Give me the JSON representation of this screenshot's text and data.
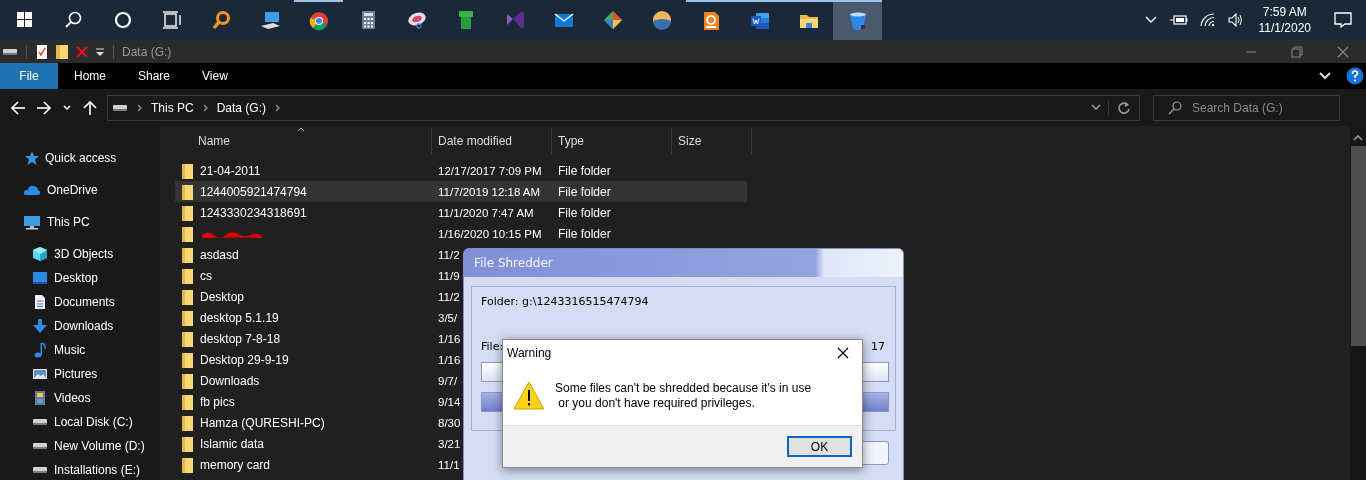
{
  "taskbar": {
    "buttons": [
      {
        "kind": "start",
        "running": false,
        "active": false
      },
      {
        "kind": "search",
        "running": false,
        "active": false
      },
      {
        "kind": "cortana",
        "running": false,
        "active": false
      },
      {
        "kind": "taskview",
        "running": false,
        "active": false
      },
      {
        "kind": "magnifier",
        "running": false,
        "active": false
      },
      {
        "kind": "computer",
        "running": false,
        "active": false
      },
      {
        "kind": "browser",
        "running": true,
        "active": false
      },
      {
        "kind": "calculator",
        "running": false,
        "active": false
      },
      {
        "kind": "disc",
        "running": false,
        "active": false
      },
      {
        "kind": "pipe",
        "running": false,
        "active": false
      },
      {
        "kind": "bow",
        "running": false,
        "active": false
      },
      {
        "kind": "mail",
        "running": false,
        "active": false
      },
      {
        "kind": "diamond",
        "running": false,
        "active": false
      },
      {
        "kind": "sunset",
        "running": false,
        "active": false
      },
      {
        "kind": "pdf",
        "running": true,
        "active": false
      },
      {
        "kind": "doc",
        "running": true,
        "active": false
      },
      {
        "kind": "folder",
        "running": true,
        "active": false
      },
      {
        "kind": "bucket",
        "running": true,
        "active": true
      }
    ],
    "tray": {
      "time": "7:59 AM",
      "date": "11/1/2020"
    }
  },
  "window": {
    "title": "Data (G:)"
  },
  "ribbon": {
    "tabs": [
      {
        "label": "File",
        "selected": true
      },
      {
        "label": "Home",
        "selected": false
      },
      {
        "label": "Share",
        "selected": false
      },
      {
        "label": "View",
        "selected": false
      }
    ]
  },
  "address": {
    "crumbs": [
      "This PC",
      "Data (G:)"
    ]
  },
  "search": {
    "placeholder": "Search Data (G:)"
  },
  "navigation": [
    {
      "label": "Quick access",
      "kind": "star"
    },
    {
      "label": "OneDrive",
      "kind": "cloud"
    },
    {
      "label": "This PC",
      "kind": "computer",
      "children": [
        {
          "label": "3D Objects",
          "kind": "cube"
        },
        {
          "label": "Desktop",
          "kind": "desktop"
        },
        {
          "label": "Documents",
          "kind": "document"
        },
        {
          "label": "Downloads",
          "kind": "download"
        },
        {
          "label": "Music",
          "kind": "note"
        },
        {
          "label": "Pictures",
          "kind": "pictures"
        },
        {
          "label": "Videos",
          "kind": "film"
        },
        {
          "label": "Local Disk (C:)",
          "kind": "drive"
        },
        {
          "label": "New Volume (D:)",
          "kind": "drive"
        },
        {
          "label": "Installations (E:)",
          "kind": "drive"
        }
      ]
    }
  ],
  "table": {
    "columns": [
      "Name",
      "Date modified",
      "Type",
      "Size"
    ],
    "rows": [
      {
        "name": "21-04-2011",
        "date": "12/17/2017 7:09 PM",
        "type": "File folder",
        "selected": false,
        "redacted": false
      },
      {
        "name": "1244005921474794",
        "date": "11/7/2019 12:18 AM",
        "type": "File folder",
        "selected": true,
        "redacted": false
      },
      {
        "name": "1243330234318691",
        "date": "11/1/2020 7:47 AM",
        "type": "File folder",
        "selected": false,
        "redacted": false
      },
      {
        "date": "1/16/2020 10:15 PM",
        "type": "File folder",
        "selected": false,
        "redacted": true
      },
      {
        "name": "asdasd",
        "date": "11/2",
        "selected": false,
        "redacted": false
      },
      {
        "name": "cs",
        "date": "11/9",
        "selected": false,
        "redacted": false
      },
      {
        "name": "Desktop",
        "date": "11/2",
        "selected": false,
        "redacted": false
      },
      {
        "name": "desktop 5.1.19",
        "date": "3/5/",
        "selected": false,
        "redacted": false
      },
      {
        "name": "desktop 7-8-18",
        "date": "1/16",
        "selected": false,
        "redacted": false
      },
      {
        "name": "Desktop 29-9-19",
        "date": "1/16",
        "selected": false,
        "redacted": false
      },
      {
        "name": "Downloads",
        "date": "9/7/",
        "selected": false,
        "redacted": false
      },
      {
        "name": "fb pics",
        "date": "9/14",
        "selected": false,
        "redacted": false
      },
      {
        "name": "Hamza (QURESHI-PC)",
        "date": "8/30",
        "selected": false,
        "redacted": false
      },
      {
        "name": "Islamic data",
        "date": "3/21",
        "selected": false,
        "redacted": false
      },
      {
        "name": "memory card",
        "date": "11/1",
        "selected": false,
        "redacted": false
      }
    ]
  },
  "shredder": {
    "title": "File Shredder",
    "folder": "Folder: g:\\1243316515474794",
    "file_label": "File:",
    "count": "17",
    "bars": [
      {
        "level": 0
      },
      {
        "level": 1
      }
    ]
  },
  "warning": {
    "title": "Warning",
    "message": "Some files can't be shredded because it's in use\n or you don't have required privileges.",
    "button": "OK"
  }
}
